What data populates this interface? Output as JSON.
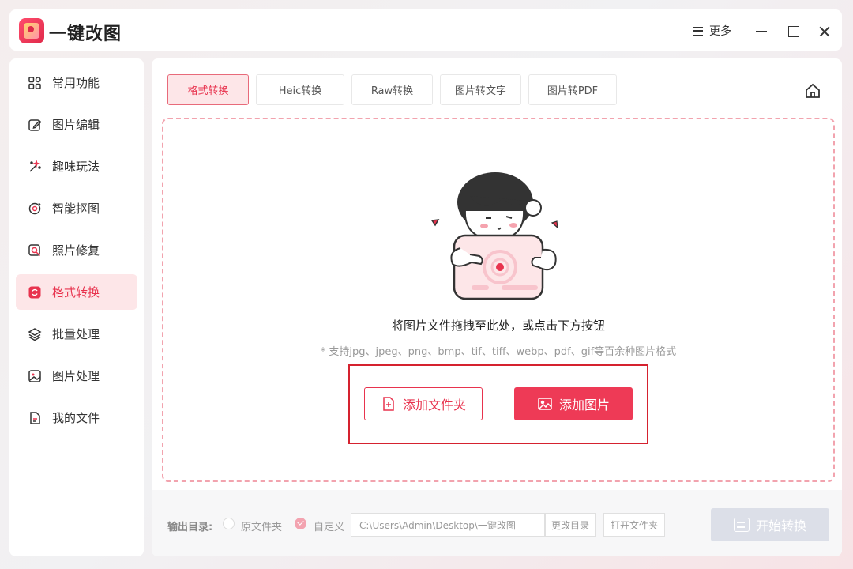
{
  "app": {
    "title": "一键改图",
    "more_label": "更多"
  },
  "sidebar": {
    "items": [
      {
        "label": "常用功能",
        "icon": "grid-icon"
      },
      {
        "label": "图片编辑",
        "icon": "edit-icon"
      },
      {
        "label": "趣味玩法",
        "icon": "magic-wand-icon"
      },
      {
        "label": "智能抠图",
        "icon": "target-icon"
      },
      {
        "label": "照片修复",
        "icon": "photo-repair-icon"
      },
      {
        "label": "格式转换",
        "icon": "convert-icon",
        "active": true
      },
      {
        "label": "批量处理",
        "icon": "layers-icon"
      },
      {
        "label": "图片处理",
        "icon": "image-icon"
      },
      {
        "label": "我的文件",
        "icon": "file-icon"
      }
    ]
  },
  "tabs": [
    {
      "label": "格式转换",
      "active": true
    },
    {
      "label": "Heic转换"
    },
    {
      "label": "Raw转换"
    },
    {
      "label": "图片转文字"
    },
    {
      "label": "图片转PDF"
    }
  ],
  "dropzone": {
    "main_text": "将图片文件拖拽至此处，或点击下方按钮",
    "sub_text": "* 支持jpg、jpeg、png、bmp、tif、tiff、webp、pdf、gif等百余种图片格式",
    "add_folder_label": "添加文件夹",
    "add_image_label": "添加图片"
  },
  "output": {
    "label": "输出目录:",
    "option_original": "原文件夹",
    "option_custom": "自定义",
    "selected": "自定义",
    "path": "C:\\Users\\Admin\\Desktop\\一键改图",
    "change_dir_label": "更改目录",
    "open_folder_label": "打开文件夹",
    "start_label": "开始转换"
  },
  "colors": {
    "accent": "#ee3a56",
    "accent_light": "#fde6e8",
    "highlight_box": "#d5222f",
    "disabled": "#dcdfe8"
  }
}
